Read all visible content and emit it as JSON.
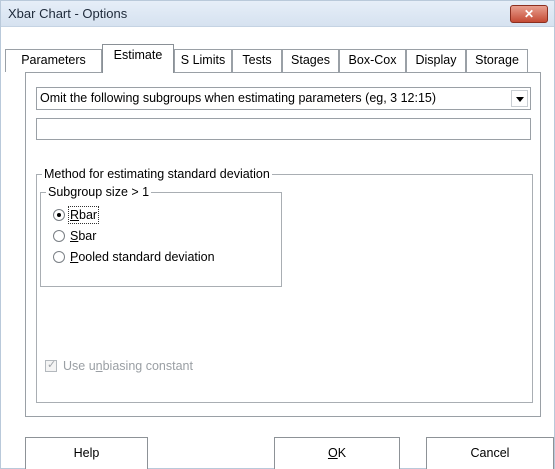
{
  "window": {
    "title": "Xbar Chart - Options",
    "close_glyph": "✕"
  },
  "tabs": [
    {
      "label": "Parameters",
      "active": false
    },
    {
      "label": "Estimate",
      "active": true
    },
    {
      "label": "S Limits",
      "active": false
    },
    {
      "label": "Tests",
      "active": false
    },
    {
      "label": "Stages",
      "active": false
    },
    {
      "label": "Box-Cox",
      "active": false
    },
    {
      "label": "Display",
      "active": false
    },
    {
      "label": "Storage",
      "active": false
    }
  ],
  "estimate": {
    "omit_select_value": "Omit the following subgroups when estimating parameters (eg, 3 12:15)",
    "omit_input_value": "",
    "method_group_label": "Method for estimating standard deviation",
    "subgroup_group_label": "Subgroup size > 1",
    "radios": [
      {
        "label": "Rbar",
        "mnemonic": "R",
        "rest": "bar",
        "checked": true
      },
      {
        "label": "Sbar",
        "mnemonic": "S",
        "rest": "bar",
        "checked": false
      },
      {
        "label": "Pooled standard deviation",
        "mnemonic": "P",
        "rest": "ooled standard deviation",
        "checked": false
      }
    ],
    "unbiasing": {
      "pre": "Use u",
      "mnemonic": "n",
      "post": "biasing constant",
      "checked": true,
      "enabled": false
    }
  },
  "buttons": {
    "help": "Help",
    "ok_mnemonic": "O",
    "ok_rest": "K",
    "cancel": "Cancel"
  }
}
